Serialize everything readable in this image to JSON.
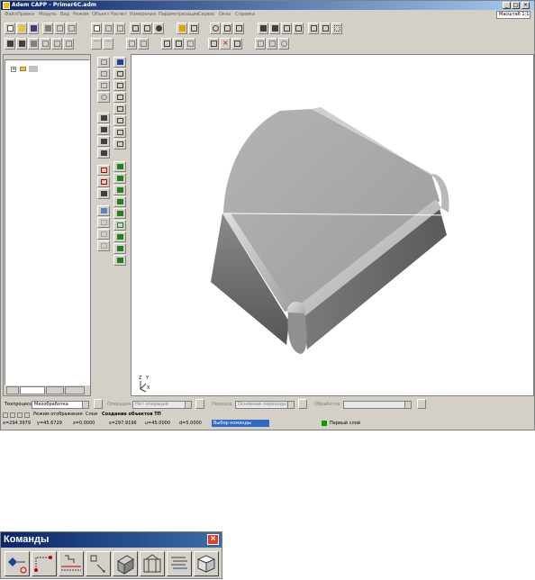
{
  "window": {
    "title": "Adem CAPP - Primer6C.adm",
    "minimize": "_",
    "maximize": "□",
    "close": "×"
  },
  "menu": {
    "items": [
      "Файл",
      "Правка",
      "Модуль",
      "Вид",
      "Режим",
      "Объект",
      "Расчет",
      "Измерения",
      "Параметризация",
      "Сервис",
      "Окно",
      "Справка"
    ]
  },
  "scale": {
    "label": "Масштаб 1:1"
  },
  "tree": {
    "expander": "+"
  },
  "process_bar": {
    "process_label": "Техпроцесс",
    "process_value": "Мехобработка",
    "operation_label": "Операция",
    "operation_value": "Нет операций",
    "transition_label": "Переход",
    "transition_value": "Основные переходы",
    "tool_label": "Обработка",
    "tool_value": ""
  },
  "sheet_tabs": [
    "Режим отображения",
    "Слои",
    "Создание объектов ТП"
  ],
  "coords": {
    "x": "x=294.3979",
    "y": "y=45.6729",
    "z": "z=0.0000",
    "s": "s=297.9196",
    "u": "u=45.0000",
    "d": "d=5.0000",
    "status": "Выбор команды",
    "layer": "Первый слой"
  },
  "axes": {
    "z": "Z",
    "y": "Y",
    "x": "X"
  },
  "commands_panel": {
    "title": "Команды",
    "close": "×"
  },
  "colors": {
    "face_top": "#a6a6a6",
    "face_side_dark": "#6a6a6a",
    "title_blue": "#0a246a",
    "selection_blue": "#316ac5"
  }
}
